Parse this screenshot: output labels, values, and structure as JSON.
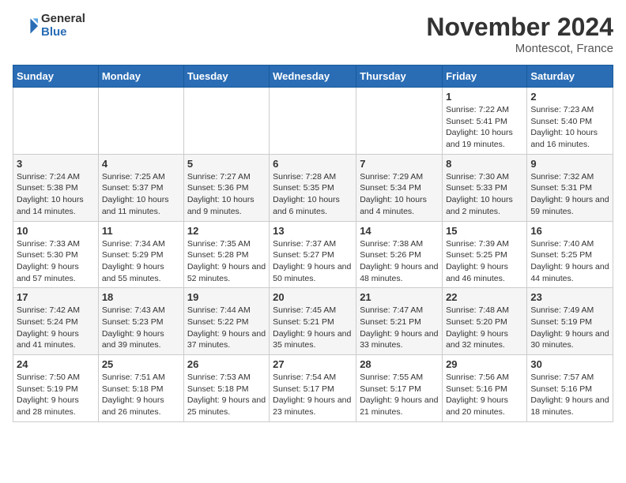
{
  "logo": {
    "general": "General",
    "blue": "Blue"
  },
  "title": "November 2024",
  "location": "Montescot, France",
  "days_of_week": [
    "Sunday",
    "Monday",
    "Tuesday",
    "Wednesday",
    "Thursday",
    "Friday",
    "Saturday"
  ],
  "weeks": [
    [
      {
        "day": "",
        "info": ""
      },
      {
        "day": "",
        "info": ""
      },
      {
        "day": "",
        "info": ""
      },
      {
        "day": "",
        "info": ""
      },
      {
        "day": "",
        "info": ""
      },
      {
        "day": "1",
        "info": "Sunrise: 7:22 AM\nSunset: 5:41 PM\nDaylight: 10 hours and 19 minutes."
      },
      {
        "day": "2",
        "info": "Sunrise: 7:23 AM\nSunset: 5:40 PM\nDaylight: 10 hours and 16 minutes."
      }
    ],
    [
      {
        "day": "3",
        "info": "Sunrise: 7:24 AM\nSunset: 5:38 PM\nDaylight: 10 hours and 14 minutes."
      },
      {
        "day": "4",
        "info": "Sunrise: 7:25 AM\nSunset: 5:37 PM\nDaylight: 10 hours and 11 minutes."
      },
      {
        "day": "5",
        "info": "Sunrise: 7:27 AM\nSunset: 5:36 PM\nDaylight: 10 hours and 9 minutes."
      },
      {
        "day": "6",
        "info": "Sunrise: 7:28 AM\nSunset: 5:35 PM\nDaylight: 10 hours and 6 minutes."
      },
      {
        "day": "7",
        "info": "Sunrise: 7:29 AM\nSunset: 5:34 PM\nDaylight: 10 hours and 4 minutes."
      },
      {
        "day": "8",
        "info": "Sunrise: 7:30 AM\nSunset: 5:33 PM\nDaylight: 10 hours and 2 minutes."
      },
      {
        "day": "9",
        "info": "Sunrise: 7:32 AM\nSunset: 5:31 PM\nDaylight: 9 hours and 59 minutes."
      }
    ],
    [
      {
        "day": "10",
        "info": "Sunrise: 7:33 AM\nSunset: 5:30 PM\nDaylight: 9 hours and 57 minutes."
      },
      {
        "day": "11",
        "info": "Sunrise: 7:34 AM\nSunset: 5:29 PM\nDaylight: 9 hours and 55 minutes."
      },
      {
        "day": "12",
        "info": "Sunrise: 7:35 AM\nSunset: 5:28 PM\nDaylight: 9 hours and 52 minutes."
      },
      {
        "day": "13",
        "info": "Sunrise: 7:37 AM\nSunset: 5:27 PM\nDaylight: 9 hours and 50 minutes."
      },
      {
        "day": "14",
        "info": "Sunrise: 7:38 AM\nSunset: 5:26 PM\nDaylight: 9 hours and 48 minutes."
      },
      {
        "day": "15",
        "info": "Sunrise: 7:39 AM\nSunset: 5:25 PM\nDaylight: 9 hours and 46 minutes."
      },
      {
        "day": "16",
        "info": "Sunrise: 7:40 AM\nSunset: 5:25 PM\nDaylight: 9 hours and 44 minutes."
      }
    ],
    [
      {
        "day": "17",
        "info": "Sunrise: 7:42 AM\nSunset: 5:24 PM\nDaylight: 9 hours and 41 minutes."
      },
      {
        "day": "18",
        "info": "Sunrise: 7:43 AM\nSunset: 5:23 PM\nDaylight: 9 hours and 39 minutes."
      },
      {
        "day": "19",
        "info": "Sunrise: 7:44 AM\nSunset: 5:22 PM\nDaylight: 9 hours and 37 minutes."
      },
      {
        "day": "20",
        "info": "Sunrise: 7:45 AM\nSunset: 5:21 PM\nDaylight: 9 hours and 35 minutes."
      },
      {
        "day": "21",
        "info": "Sunrise: 7:47 AM\nSunset: 5:21 PM\nDaylight: 9 hours and 33 minutes."
      },
      {
        "day": "22",
        "info": "Sunrise: 7:48 AM\nSunset: 5:20 PM\nDaylight: 9 hours and 32 minutes."
      },
      {
        "day": "23",
        "info": "Sunrise: 7:49 AM\nSunset: 5:19 PM\nDaylight: 9 hours and 30 minutes."
      }
    ],
    [
      {
        "day": "24",
        "info": "Sunrise: 7:50 AM\nSunset: 5:19 PM\nDaylight: 9 hours and 28 minutes."
      },
      {
        "day": "25",
        "info": "Sunrise: 7:51 AM\nSunset: 5:18 PM\nDaylight: 9 hours and 26 minutes."
      },
      {
        "day": "26",
        "info": "Sunrise: 7:53 AM\nSunset: 5:18 PM\nDaylight: 9 hours and 25 minutes."
      },
      {
        "day": "27",
        "info": "Sunrise: 7:54 AM\nSunset: 5:17 PM\nDaylight: 9 hours and 23 minutes."
      },
      {
        "day": "28",
        "info": "Sunrise: 7:55 AM\nSunset: 5:17 PM\nDaylight: 9 hours and 21 minutes."
      },
      {
        "day": "29",
        "info": "Sunrise: 7:56 AM\nSunset: 5:16 PM\nDaylight: 9 hours and 20 minutes."
      },
      {
        "day": "30",
        "info": "Sunrise: 7:57 AM\nSunset: 5:16 PM\nDaylight: 9 hours and 18 minutes."
      }
    ]
  ]
}
